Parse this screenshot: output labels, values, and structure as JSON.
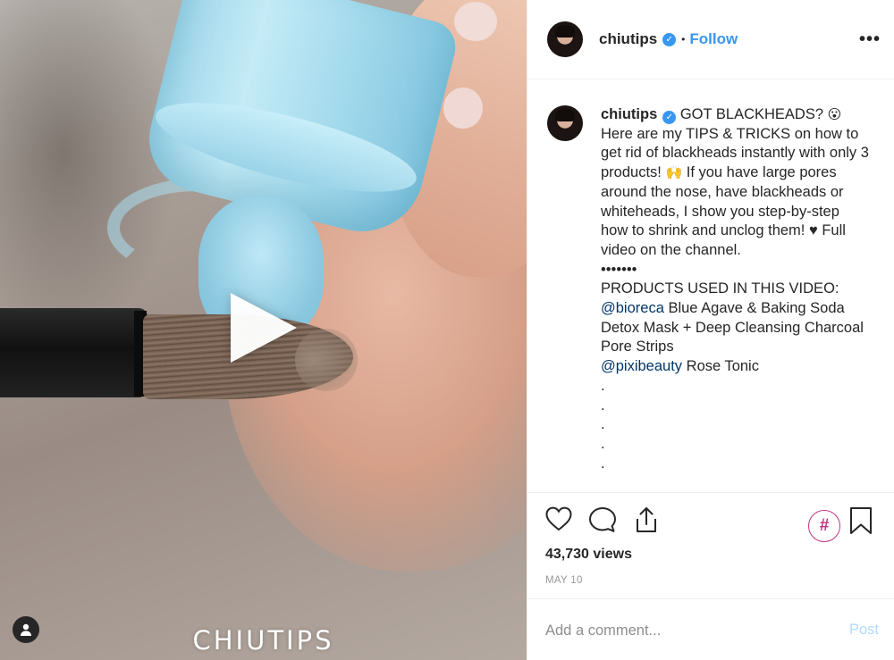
{
  "post": {
    "username": "chiutips",
    "verified_mark": "✓",
    "separator": "•",
    "follow_label": "Follow",
    "more_label": "•••"
  },
  "media": {
    "watermark": "CHIUTIPS",
    "play_icon": "play-icon"
  },
  "caption": {
    "username": "chiutips",
    "verified_mark": "✓",
    "intro": " GOT BLACKHEADS? ",
    "emoji_1": "😮",
    "text_1": " Here are my TIPS & TRICKS on how to get rid of blackheads instantly with only 3 products! ",
    "emoji_2": "🙌",
    "text_2": " If you have large pores around the nose, have blackheads or whiteheads, I show you step-by-step how to shrink and unclog them! ♥ Full video on the channel.",
    "bullets": "•••••••",
    "products_heading": "PRODUCTS USED IN THIS VIDEO:",
    "mention_1": "@bioreca",
    "product_1": " Blue Agave & Baking Soda Detox Mask + Deep Cleansing Charcoal Pore Strips",
    "mention_2": "@pixibeauty",
    "product_2": " Rose Tonic",
    "dots": [
      ".",
      ".",
      ".",
      ".",
      "."
    ]
  },
  "actions": {
    "like_icon": "heart-icon",
    "comment_icon": "speech-bubble-icon",
    "share_icon": "share-icon",
    "hashtag_label": "#",
    "save_icon": "bookmark-icon",
    "views": "43,730 views",
    "date": "MAY 10"
  },
  "comment_form": {
    "placeholder": "Add a comment...",
    "post_label": "Post"
  },
  "colors": {
    "accent_blue": "#3897f0",
    "post_disabled": "#b3dbff",
    "mention": "#00376b",
    "hashtag": "#c13584",
    "text": "#262626",
    "muted": "#999999"
  }
}
